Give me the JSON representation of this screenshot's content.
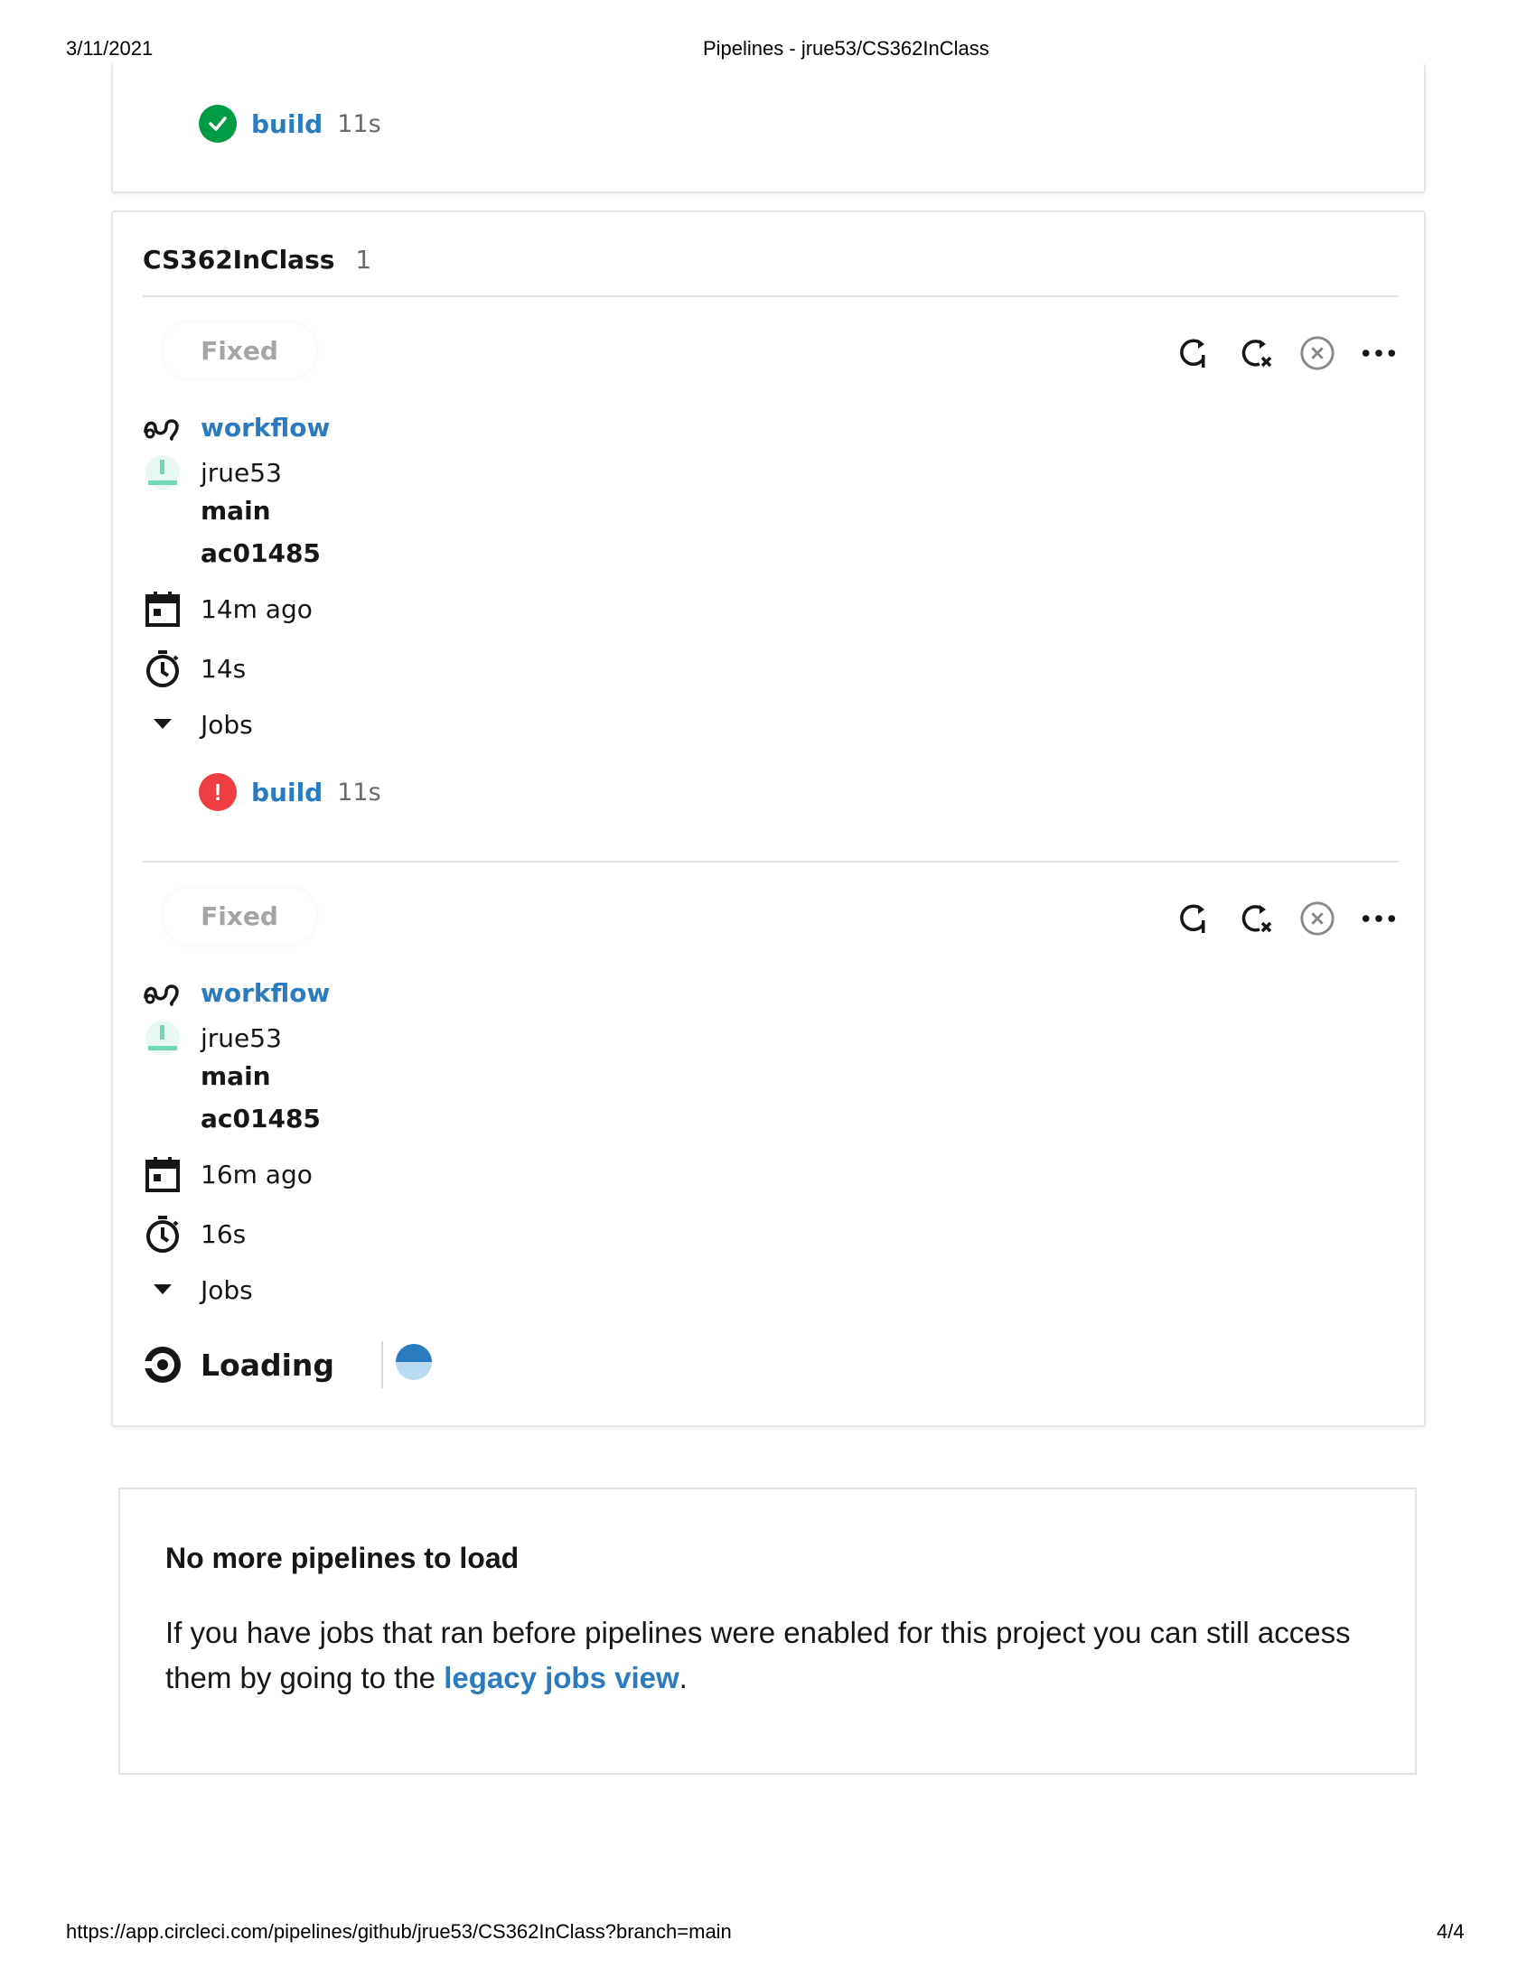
{
  "print_header": {
    "date": "3/11/2021",
    "title": "Pipelines - jrue53/CS362InClass"
  },
  "print_footer": {
    "url": "https://app.circleci.com/pipelines/github/jrue53/CS362InClass?branch=main",
    "page": "4/4"
  },
  "top_card": {
    "job": {
      "name": "build",
      "duration": "11s",
      "status": "success"
    }
  },
  "project": {
    "name": "CS362InClass",
    "count": "1",
    "pipelines": [
      {
        "status": "Fixed",
        "workflow": "workflow",
        "user": "jrue53",
        "branch": "main",
        "commit": "ac01485",
        "time_ago": "14m ago",
        "duration": "14s",
        "jobs_label": "Jobs",
        "job": {
          "name": "build",
          "duration": "11s",
          "status": "failed",
          "status_glyph": "!"
        }
      },
      {
        "status": "Fixed",
        "workflow": "workflow",
        "user": "jrue53",
        "branch": "main",
        "commit": "ac01485",
        "time_ago": "16m ago",
        "duration": "16s",
        "jobs_label": "Jobs",
        "loading_label": "Loading"
      }
    ]
  },
  "no_more": {
    "title": "No more pipelines to load",
    "text_before": "If you have jobs that ran before pipelines were enabled for this project you can still access them by going to the ",
    "link": "legacy jobs view",
    "text_after": "."
  },
  "colors": {
    "link": "#2a7bbf",
    "success": "#029b45",
    "error": "#ef3e42",
    "badge_text": "#a5a5a5"
  }
}
